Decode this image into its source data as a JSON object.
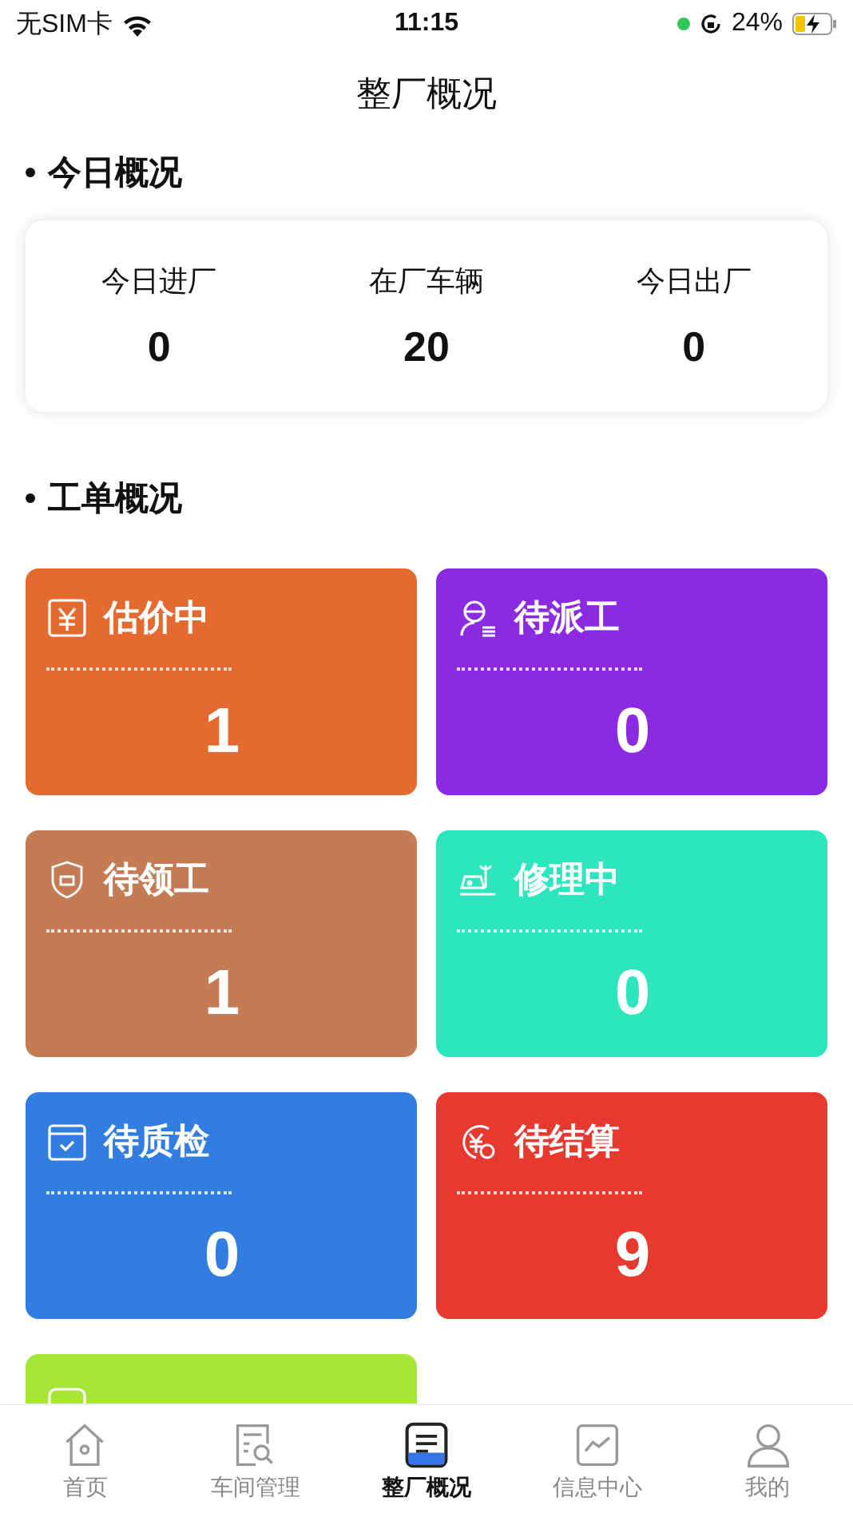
{
  "status_bar": {
    "carrier": "无SIM卡",
    "time": "11:15",
    "battery": "24%"
  },
  "header": {
    "title": "整厂概况"
  },
  "today": {
    "title": "今日概况",
    "stats": [
      {
        "label": "今日进厂",
        "value": "0"
      },
      {
        "label": "在厂车辆",
        "value": "20"
      },
      {
        "label": "今日出厂",
        "value": "0"
      }
    ]
  },
  "orders": {
    "title": "工单概况",
    "cards": [
      {
        "kind": "yuan",
        "label": "估价中",
        "value": "1",
        "color": "#e56a30"
      },
      {
        "kind": "dispatch",
        "label": "待派工",
        "value": "0",
        "color": "#8a2be2"
      },
      {
        "kind": "shield",
        "label": "待领工",
        "value": "1",
        "color": "#c47c54"
      },
      {
        "kind": "repair",
        "label": "修理中",
        "value": "0",
        "color": "#2ee6bd"
      },
      {
        "kind": "check",
        "label": "待质检",
        "value": "0",
        "color": "#317ee0"
      },
      {
        "kind": "settle",
        "label": "待结算",
        "value": "9",
        "color": "#e63a30"
      },
      {
        "kind": "exit",
        "color": "#a6e636"
      }
    ]
  },
  "tab_bar": [
    {
      "kind": "home",
      "label": "首页",
      "selected": false
    },
    {
      "kind": "workshop",
      "label": "车间管理",
      "selected": false
    },
    {
      "kind": "overview",
      "label": "整厂概况",
      "selected": true
    },
    {
      "kind": "info",
      "label": "信息中心",
      "selected": false
    },
    {
      "kind": "user",
      "label": "我的",
      "selected": false
    }
  ]
}
